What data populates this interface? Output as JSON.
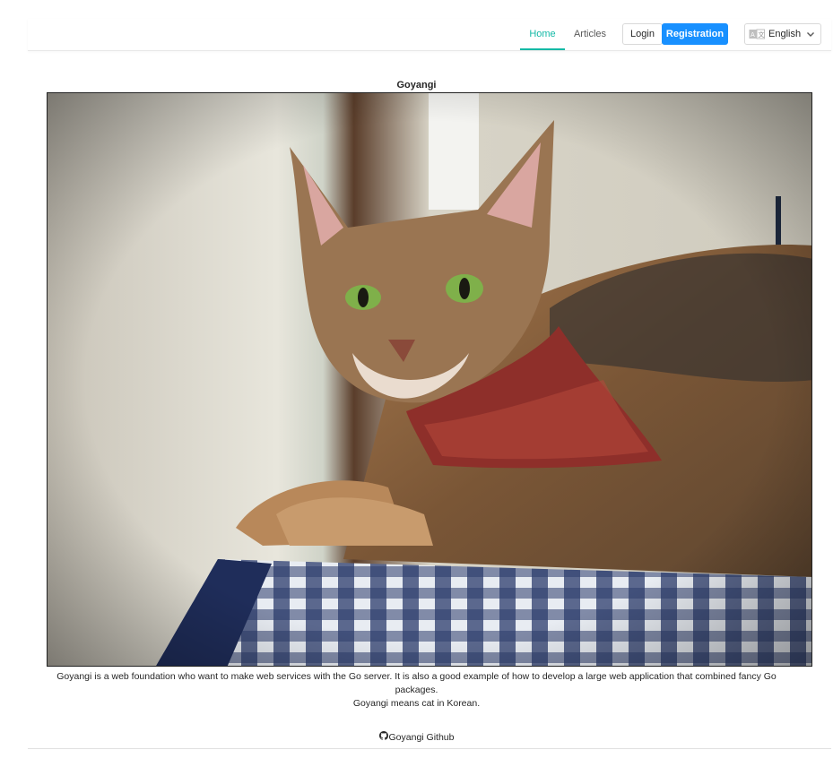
{
  "nav": {
    "home": "Home",
    "articles": "Articles",
    "login": "Login",
    "registration": "Registration",
    "language": "English",
    "language_icon": "translate-icon"
  },
  "main": {
    "title": "Goyangi",
    "image_subject": "cat-photo",
    "description_line1": "Goyangi is a web foundation who want to make web services with the Go server. It is also a good example of how to develop a large web application that combined fancy Go packages.",
    "description_line2": "Goyangi means cat in Korean."
  },
  "footer": {
    "github_label": "Goyangi Github",
    "github_icon": "github-icon"
  },
  "colors": {
    "accent": "#13b9a6",
    "primary": "#1890ff"
  }
}
